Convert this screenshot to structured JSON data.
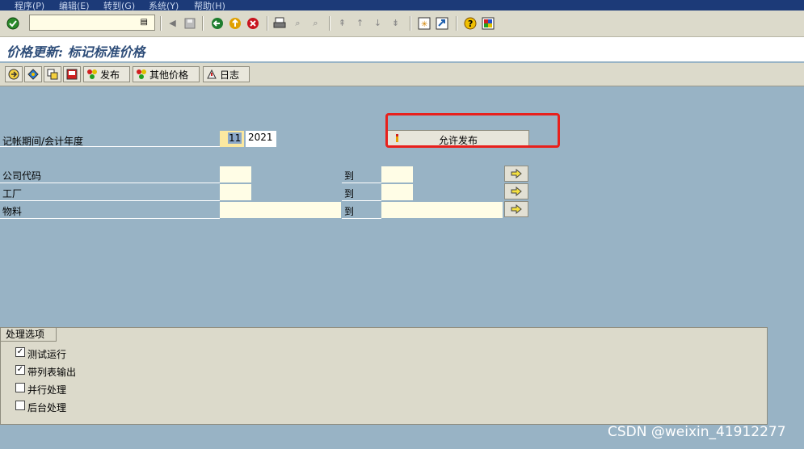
{
  "menu": [
    "程序(P)",
    "编辑(E)",
    "转到(G)",
    "系统(Y)",
    "帮助(H)"
  ],
  "page_title": "价格更新: 标记标准价格",
  "app_toolbar": {
    "release_label": "发布",
    "other_prices_label": "其他价格",
    "log_label": "日志"
  },
  "form": {
    "period_label": "记帐期间/会计年度",
    "period_value": "11",
    "year_value": "2021",
    "allow_release_label": "允许发布",
    "company_code_label": "公司代码",
    "plant_label": "工厂",
    "material_label": "物料",
    "to_label": "到"
  },
  "group": {
    "title": "处理选项",
    "options": [
      {
        "label": "测试运行",
        "checked": true
      },
      {
        "label": "带列表输出",
        "checked": true
      },
      {
        "label": "并行处理",
        "checked": false
      },
      {
        "label": "后台处理",
        "checked": false
      }
    ]
  },
  "watermark": "CSDN @weixin_41912277",
  "colors": {
    "background": "#98b3c5",
    "menubar": "#1c3a78",
    "title": "#2e4d79",
    "highlight_box": "#e8201c",
    "input": "#fffde6"
  }
}
